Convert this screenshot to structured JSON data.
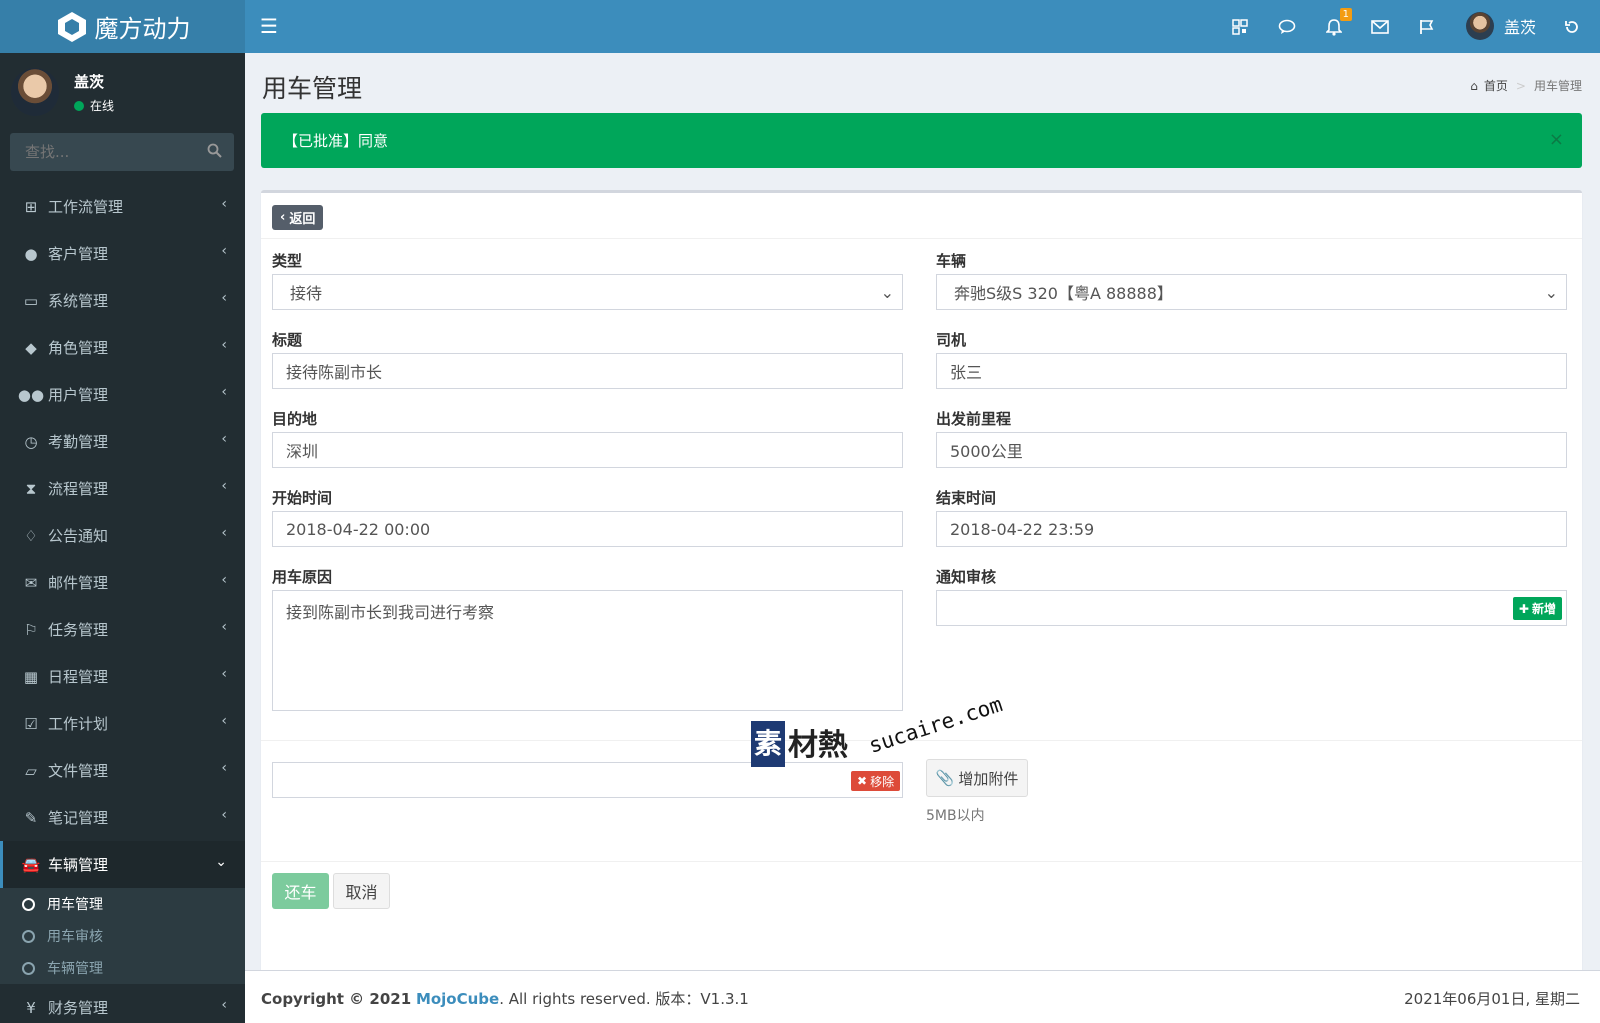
{
  "app": {
    "title": "魔方动力"
  },
  "header": {
    "notifications_count": "1",
    "user_name": "盖茨"
  },
  "sidebar": {
    "user": {
      "name": "盖茨",
      "status": "在线"
    },
    "search_placeholder": "查找...",
    "items": [
      {
        "label": "工作流管理",
        "icon": "sitemap-icon"
      },
      {
        "label": "客户管理",
        "icon": "user-icon"
      },
      {
        "label": "系统管理",
        "icon": "desktop-icon"
      },
      {
        "label": "角色管理",
        "icon": "graduation-cap-icon"
      },
      {
        "label": "用户管理",
        "icon": "users-icon"
      },
      {
        "label": "考勤管理",
        "icon": "clock-icon"
      },
      {
        "label": "流程管理",
        "icon": "hourglass-icon"
      },
      {
        "label": "公告通知",
        "icon": "bell-icon"
      },
      {
        "label": "邮件管理",
        "icon": "envelope-icon"
      },
      {
        "label": "任务管理",
        "icon": "flag-icon"
      },
      {
        "label": "日程管理",
        "icon": "calendar-icon"
      },
      {
        "label": "工作计划",
        "icon": "calendar-check-icon"
      },
      {
        "label": "文件管理",
        "icon": "folder-open-icon"
      },
      {
        "label": "笔记管理",
        "icon": "edit-icon"
      },
      {
        "label": "车辆管理",
        "icon": "car-icon"
      },
      {
        "label": "财务管理",
        "icon": "yen-icon"
      }
    ],
    "subitems": [
      {
        "label": "用车管理"
      },
      {
        "label": "用车审核"
      },
      {
        "label": "车辆管理"
      }
    ]
  },
  "page": {
    "title": "用车管理",
    "breadcrumb": {
      "home": "首页",
      "current": "用车管理"
    },
    "alert": "【已批准】同意",
    "back_label": "返回"
  },
  "form": {
    "type": {
      "label": "类型",
      "value": "接待"
    },
    "vehicle": {
      "label": "车辆",
      "value": "奔驰S级S 320【粤A 88888】"
    },
    "title": {
      "label": "标题",
      "value": "接待陈副市长"
    },
    "driver": {
      "label": "司机",
      "value": "张三"
    },
    "destination": {
      "label": "目的地",
      "value": "深圳"
    },
    "mileage": {
      "label": "出发前里程",
      "value": "5000公里"
    },
    "start_time": {
      "label": "开始时间",
      "value": "2018-04-22 00:00"
    },
    "end_time": {
      "label": "结束时间",
      "value": "2018-04-22 23:59"
    },
    "reason": {
      "label": "用车原因",
      "value": "接到陈副市长到我司进行考察"
    },
    "notify": {
      "label": "通知审核",
      "add_label": "新增"
    },
    "attachment": {
      "add_label": "增加附件",
      "hint": "5MB以内",
      "remove_label": "移除"
    },
    "actions": {
      "return_label": "还车",
      "cancel_label": "取消"
    }
  },
  "watermark": {
    "logo": "素",
    "text": "材熱",
    "url": "sucaire.com"
  },
  "footer": {
    "copyright_prefix": "Copyright © 2021",
    "brand": "MojoCube",
    "rights": ". All rights reserved. 版本：V1.3.1",
    "date": "2021年06月01日, 星期二"
  },
  "colors": {
    "header": "#3c8dbc",
    "logo_bg": "#367fa9",
    "sidebar": "#222d32",
    "success": "#00a65a",
    "danger": "#dd4b39"
  }
}
